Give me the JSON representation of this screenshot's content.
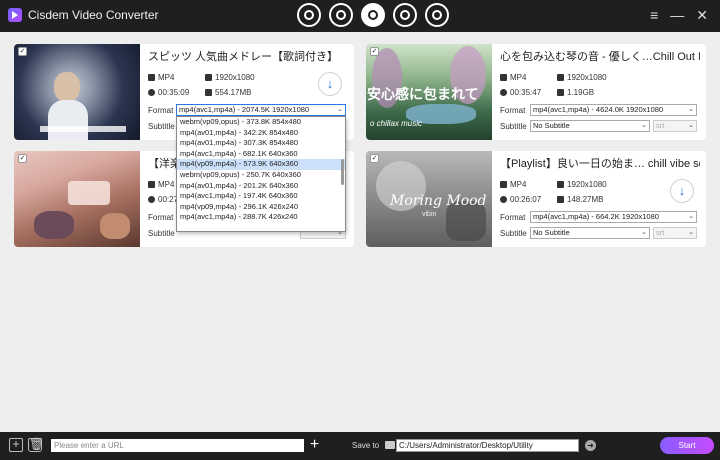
{
  "app": {
    "title": "Cisdem Video Converter",
    "modes": [
      "convert-icon",
      "compress-icon",
      "download-icon",
      "burn-icon",
      "rip-icon"
    ],
    "active_mode": 2,
    "menu_icon": "≡",
    "minimize_icon": "—",
    "close_icon": "✕"
  },
  "cards": [
    {
      "title": "スピッツ 人気曲メドレー【歌詞付き】",
      "format_type": "MP4",
      "resolution": "1920x1080",
      "duration": "00:35:09",
      "size": "554.17MB",
      "format_label": "Format",
      "format_value": "mp4(avc1,mp4a) - 2074.5K 1920x1080",
      "subtitle_label": "Subtitle",
      "subtitle_value": "No Subtitle",
      "srt_value": "srt"
    },
    {
      "title": "心を包み込む琴の音 - 優しく…Chill Out Mu",
      "format_type": "MP4",
      "resolution": "1920x1080",
      "duration": "00:35:47",
      "size": "1.19GB",
      "format_label": "Format",
      "format_value": "mp4(avc1,mp4a) - 4624.0K 1920x1080",
      "subtitle_label": "Subtitle",
      "subtitle_value": "No Subtitle",
      "srt_value": "srt"
    },
    {
      "title": "【洋楽",
      "format_type": "MP4",
      "resolution": "",
      "duration": "00:27",
      "size": "",
      "format_label": "Format",
      "format_value": "",
      "subtitle_label": "Subtitle",
      "subtitle_value": "No Subtitle",
      "srt_value": "srt"
    },
    {
      "title": "【Playlist】良い一日の始ま… chill vibe sor",
      "format_type": "MP4",
      "resolution": "1920x1080",
      "duration": "00:26:07",
      "size": "148.27MB",
      "format_label": "Format",
      "format_value": "mp4(avc1,mp4a) - 664.2K 1920x1080",
      "subtitle_label": "Subtitle",
      "subtitle_value": "No Subtitle",
      "srt_value": "srt"
    }
  ],
  "thumbs": {
    "card2_text": "安心感に包まれて",
    "card2_sub": "o chillax music",
    "card4_text": "Moring Mood",
    "card4_sub": "vibin"
  },
  "format_dropdown": {
    "options": [
      "webm(vp09,opus) - 373.8K 854x480",
      "mp4(av01,mp4a) - 342.2K 854x480",
      "mp4(av01,mp4a) - 307.3K 854x480",
      "mp4(avc1,mp4a) - 682.1K 640x360",
      "mp4(vp09,mp4a) - 573.9K 640x360",
      "webm(vp09,opus) - 250.7K 640x360",
      "mp4(av01,mp4a) - 201.2K 640x360",
      "mp4(avc1,mp4a) - 197.4K 640x360",
      "mp4(vp09,mp4a) - 296.1K 426x240",
      "mp4(avc1,mp4a) - 288.7K 426x240"
    ],
    "selected_index": 4
  },
  "bottom": {
    "url_placeholder": "Please enter a URL",
    "save_to_label": "Save to",
    "save_path": "C:/Users/Administrator/Desktop/Utility",
    "start_label": "Start"
  },
  "colors": {
    "accent": "#1e6fd9",
    "start_gradient_from": "#8a5cff",
    "start_gradient_to": "#c44cff"
  }
}
